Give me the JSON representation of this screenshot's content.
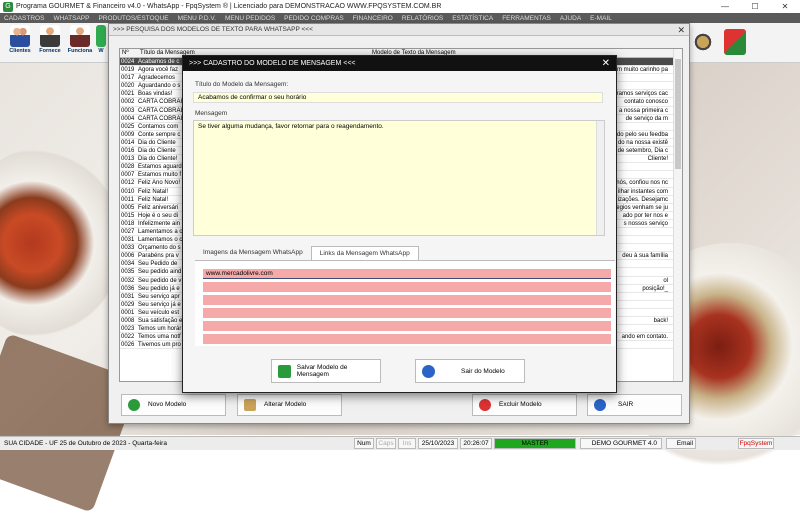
{
  "window": {
    "title": "Programa GOURMET & Financeiro v4.0 - WhatsApp - FpqSystem ® | Licenciado para  DEMONSTRACAO WWW.FPQSYSTEM.COM.BR",
    "min_label": "—",
    "max_label": "☐",
    "close_label": "✕"
  },
  "menu": [
    "CADASTROS",
    "WHATSAPP",
    "PRODUTOS/ESTOQUE",
    "MENU P.D.V.",
    "MENU PEDIDOS",
    "PEDIDO COMPRAS",
    "FINANCEIRO",
    "RELATÓRIOS",
    "ESTATÍSTICA",
    "FERRAMENTAS",
    "AJUDA",
    "E-MAIL"
  ],
  "toolbar": {
    "clientes": "Clientes",
    "fornece": "Fornece",
    "funciona": "Funciona",
    "whats": "W"
  },
  "search_window": {
    "title": ">>> PESQUISA DOS MODELOS DE TEXTO PARA WHATSAPP <<<",
    "close_label": "✕",
    "col_num": "Nº",
    "col_title": "Título da Mensagem",
    "col_model": "Modelo de Texto da Mensagem",
    "rows": [
      {
        "n": "0024",
        "t": "Acabamos de c",
        "m": ""
      },
      {
        "n": "0019",
        "t": "Agora você faz",
        "m": "om muito carinho pa"
      },
      {
        "n": "0017",
        "t": "Agradecemos",
        "m": ""
      },
      {
        "n": "0020",
        "t": "Aguardando o s",
        "m": ""
      },
      {
        "n": "0021",
        "t": "Boas vindas!",
        "m": "eramos serviços cac"
      },
      {
        "n": "0002",
        "t": "CARTA COBRAI",
        "m": "contato conosco"
      },
      {
        "n": "0003",
        "t": "CARTA COBRAI",
        "m": "a nossa primeira c"
      },
      {
        "n": "0004",
        "t": "CARTA COBRAI",
        "m": "de serviço da m"
      },
      {
        "n": "0025",
        "t": "Contamos com",
        "m": ""
      },
      {
        "n": "0009",
        "t": "Conte sempre c",
        "m": "ado pelo seu feedba"
      },
      {
        "n": "0014",
        "t": "Dia do Cliente",
        "m": "do na nossa existê"
      },
      {
        "n": "0016",
        "t": "Dia do Cliente",
        "m": "de setembro, Dia c"
      },
      {
        "n": "0013",
        "t": "Dia do Cliente!",
        "m": "Cliente!"
      },
      {
        "n": "0028",
        "t": "Estamos aguard",
        "m": ""
      },
      {
        "n": "0007",
        "t": "Estamos muito f",
        "m": ""
      },
      {
        "n": "0012",
        "t": "Feliz Ano Novo!",
        "m": "nós, confiou nos nc"
      },
      {
        "n": "0010",
        "t": "Feliz Natal!",
        "m": "ilhar instantes com"
      },
      {
        "n": "0011",
        "t": "Feliz Natal!",
        "m": "izações. Desejamc"
      },
      {
        "n": "0005",
        "t": "Feliz aniversári",
        "m": "egios venham se ju"
      },
      {
        "n": "0015",
        "t": "Hoje é o seu di",
        "m": "ado por ter nos e"
      },
      {
        "n": "0018",
        "t": "Infelizmente ain",
        "m": "s nossos serviço"
      },
      {
        "n": "0027",
        "t": "Lamentamos a o",
        "m": ""
      },
      {
        "n": "0031",
        "t": "Lamentamos o c",
        "m": ""
      },
      {
        "n": "0033",
        "t": "Orçamento do s",
        "m": ""
      },
      {
        "n": "0006",
        "t": "Parabéns pra v",
        "m": "deu à sua família"
      },
      {
        "n": "0034",
        "t": "Seu Pedido de",
        "m": ""
      },
      {
        "n": "0035",
        "t": "Seu pedido aind",
        "m": ""
      },
      {
        "n": "0032",
        "t": "Seu pedido de v",
        "m": "ol"
      },
      {
        "n": "0036",
        "t": "Seu pedido já e",
        "m": "posição!_"
      },
      {
        "n": "0031",
        "t": "Seu serviço apr",
        "m": ""
      },
      {
        "n": "0029",
        "t": "Seu serviço já e",
        "m": ""
      },
      {
        "n": "0001",
        "t": "Seu veículo est",
        "m": ""
      },
      {
        "n": "0008",
        "t": "Sua satisfação e",
        "m": "back!"
      },
      {
        "n": "0023",
        "t": "Temos um horár",
        "m": ""
      },
      {
        "n": "0022",
        "t": "Temos uma notf",
        "m": "ando em contato."
      },
      {
        "n": "0026",
        "t": "Tivemos um pro",
        "m": ""
      }
    ],
    "btn_novo": "Novo Modelo",
    "btn_alterar": "Alterar Modelo",
    "btn_excluir": "Excluir Modelo",
    "btn_sair": "SAIR"
  },
  "modal": {
    "title": ">>> CADASTRO DO MODELO DE MENSAGEM <<<",
    "close_label": "✕",
    "title_label": "Título do Modelo da Mensagem:",
    "title_value": "Acabamos de confirmar o seu horário",
    "message_label": "Mensagem",
    "message_value": "Se tiver alguma mudança, favor retornar para o reagendamento.",
    "tab_images": "Imagens da Mensagem WhatsApp",
    "tab_links": "Links da Mensagem WhatsApp",
    "links": [
      "www.mercadolivre.com",
      "",
      "",
      "",
      "",
      ""
    ],
    "btn_save": "Salvar Modelo de Mensagem",
    "btn_exit": "Sair do Modelo"
  },
  "status": {
    "city": "SUA CIDADE - UF 25 de Outubro de 2023 - Quarta-feira",
    "num": "Num",
    "caps": "Caps",
    "ins": "Ins",
    "date": "25/10/2023",
    "time": "20:26:07",
    "master": "MASTER",
    "company": "DEMO GOURMET 4.0",
    "email": "Email",
    "brand": "FpqSystem"
  },
  "colors": {
    "selected_row": "#4a4a4a",
    "input_bg": "#ffffd9",
    "link_row": "#f5a9a9",
    "master_green": "#1fa81f"
  }
}
